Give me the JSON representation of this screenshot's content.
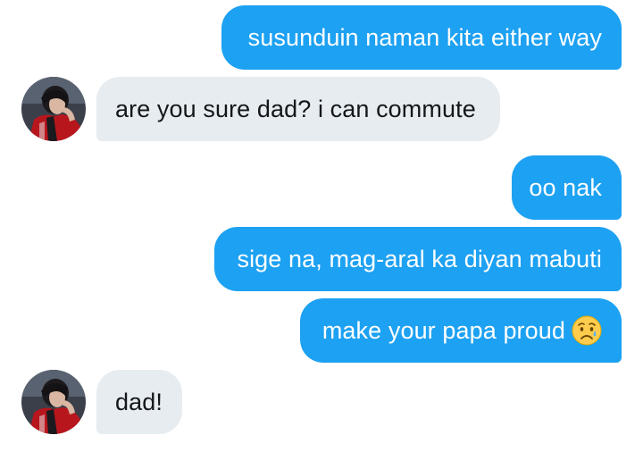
{
  "messages": [
    {
      "direction": "sent",
      "text": "susunduin naman kita either way"
    },
    {
      "direction": "received",
      "text": "are you sure dad? i can commute"
    },
    {
      "direction": "sent",
      "text": "oo nak"
    },
    {
      "direction": "sent",
      "text": "sige na, mag-aral ka diyan mabuti"
    },
    {
      "direction": "sent",
      "text": "make your papa proud",
      "emoji": "disappointed-relieved-face-emoji"
    },
    {
      "direction": "received",
      "text": "dad!"
    }
  ],
  "colors": {
    "sent_bubble": "#1da1f2",
    "received_bubble": "#e6ecf0",
    "sent_text": "#ffffff",
    "received_text": "#14171a"
  }
}
